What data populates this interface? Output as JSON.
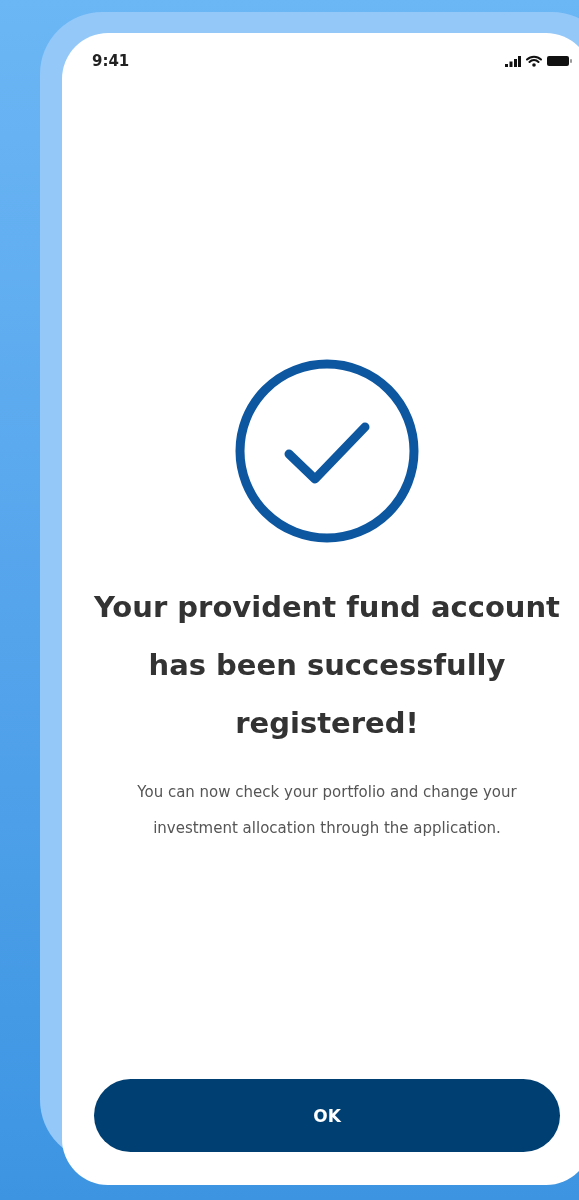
{
  "status_bar": {
    "time": "9:41"
  },
  "title": "Your provident fund account has been successfully registered!",
  "message": "You can now check your portfolio and change your investment allocation through the application.",
  "button": {
    "label": "OK"
  }
}
